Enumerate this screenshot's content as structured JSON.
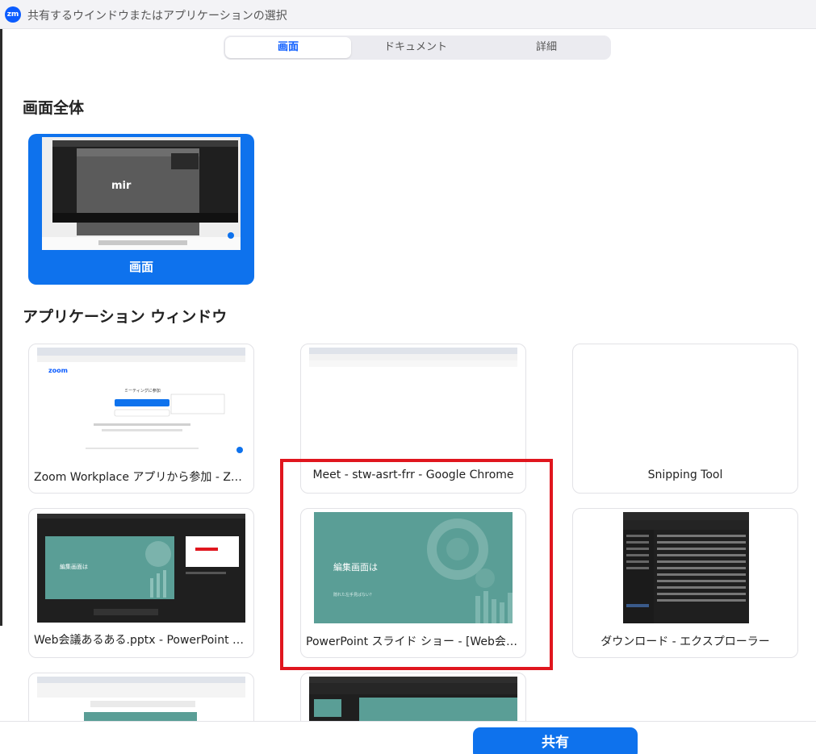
{
  "window": {
    "logo_text": "zm",
    "title": "共有するウインドウまたはアプリケーションの選択"
  },
  "tabs": [
    {
      "label": "画面",
      "active": true
    },
    {
      "label": "ドキュメント",
      "active": false
    },
    {
      "label": "詳細",
      "active": false
    }
  ],
  "sections": {
    "screen_title": "画面全体",
    "apps_title": "アプリケーション ウィンドウ"
  },
  "screen": {
    "label": "画面",
    "preview_text": "mir"
  },
  "apps": [
    {
      "label": "Zoom Workplace アプリから参加 - Zoom..."
    },
    {
      "label": "Meet - stw-asrt-frr - Google Chrome"
    },
    {
      "label": "Snipping Tool"
    },
    {
      "label": "Web会議あるある.pptx - PowerPoint 発..."
    },
    {
      "label": "PowerPoint スライド ショー - [Web会議あ..."
    },
    {
      "label": "ダウンロード - エクスプローラー"
    }
  ],
  "previews": {
    "zoom_brand": "zoom",
    "zoom_heading": "ミーティングに参加",
    "slide_title": "編集画面は",
    "slide_subtitle": "隠れた左手見ばない？"
  },
  "footer": {
    "share_label": "共有"
  },
  "colors": {
    "accent": "#0e72ed",
    "highlight": "#e0161e",
    "slide_teal": "#5a9e96"
  }
}
